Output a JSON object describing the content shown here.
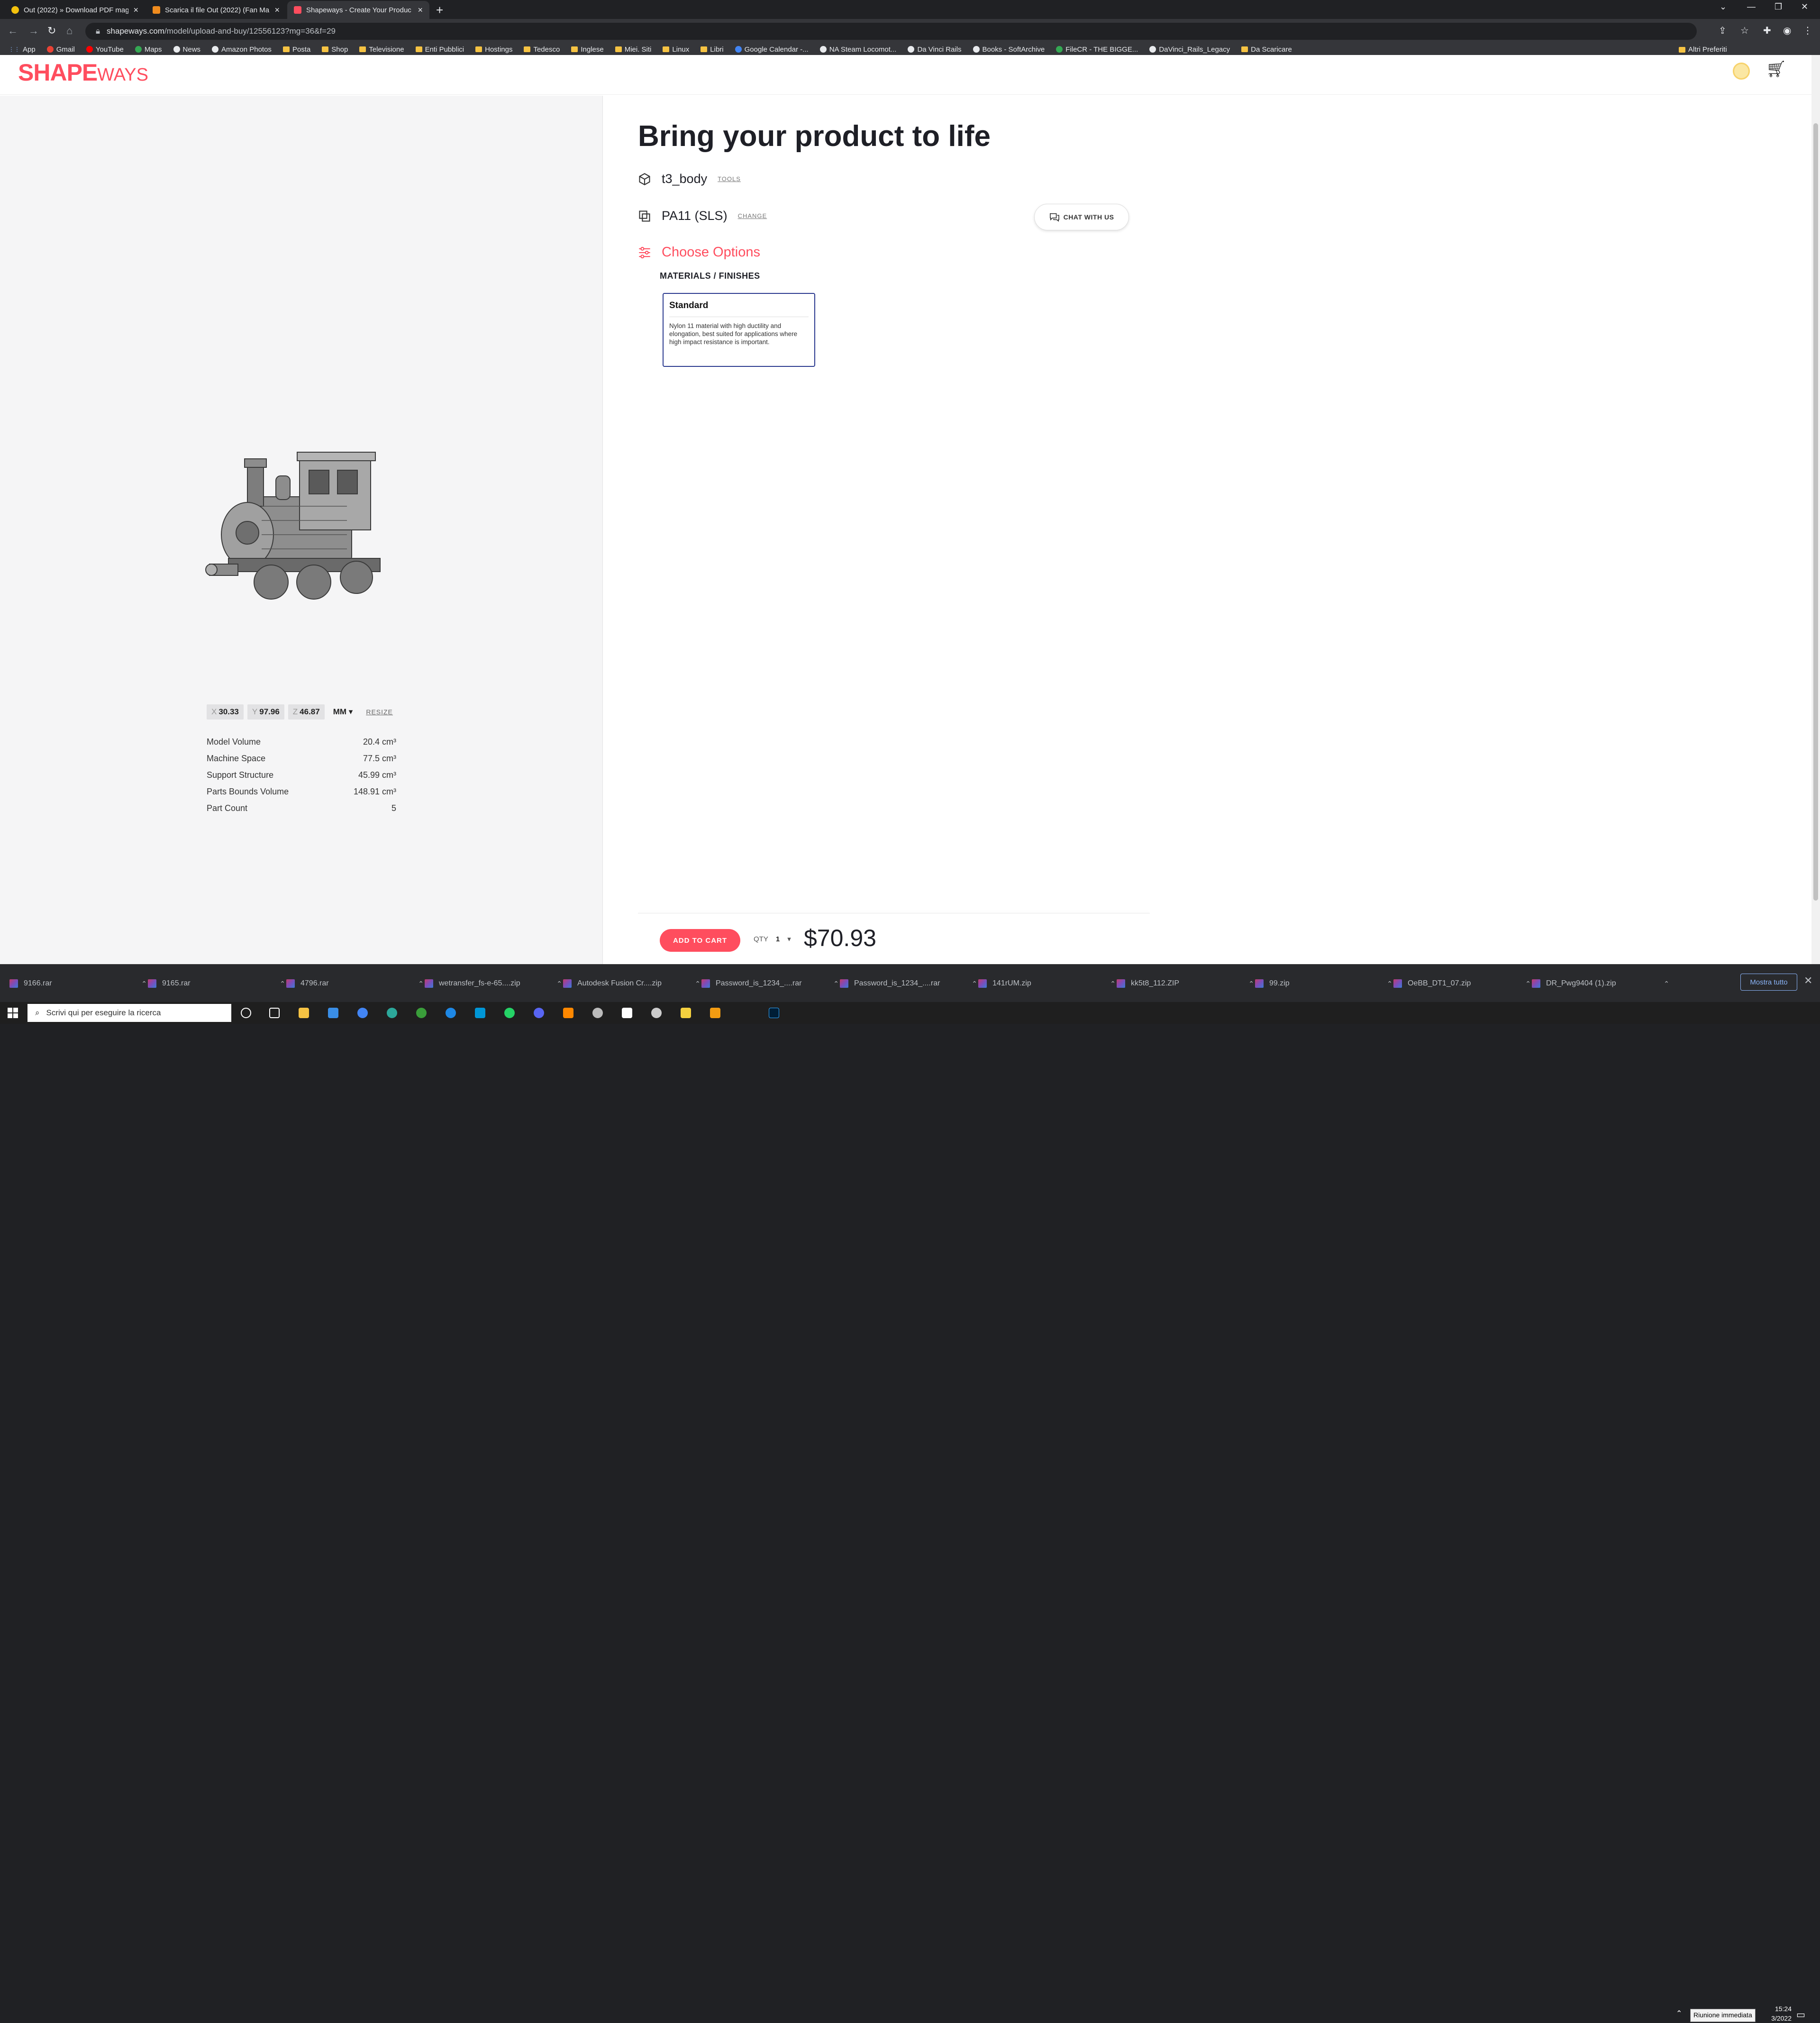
{
  "browser": {
    "tabs": [
      {
        "label": "Out (2022) » Download PDF mag",
        "favicon_color": "#f4c20d",
        "active": false
      },
      {
        "label": "Scarica il file Out (2022) (Fan Ma",
        "favicon_color": "#f08c1e",
        "active": false
      },
      {
        "label": "Shapeways - Create Your Produc",
        "favicon_color": "#ff4d5e",
        "active": true
      }
    ],
    "url_host": "shapeways.com",
    "url_path": "/model/upload-and-buy/12556123?mg=36&f=29",
    "bookmarks": [
      {
        "label": "App",
        "kind": "apps"
      },
      {
        "label": "Gmail",
        "kind": "site",
        "color": "#ea4335"
      },
      {
        "label": "YouTube",
        "kind": "site",
        "color": "#ff0000"
      },
      {
        "label": "Maps",
        "kind": "site",
        "color": "#34a853"
      },
      {
        "label": "News",
        "kind": "site",
        "color": "#e8eaed"
      },
      {
        "label": "Amazon Photos",
        "kind": "site",
        "color": "#e8eaed"
      },
      {
        "label": "Posta",
        "kind": "folder"
      },
      {
        "label": "Shop",
        "kind": "folder"
      },
      {
        "label": "Televisione",
        "kind": "folder"
      },
      {
        "label": "Enti Pubblici",
        "kind": "folder"
      },
      {
        "label": "Hostings",
        "kind": "folder"
      },
      {
        "label": "Tedesco",
        "kind": "folder"
      },
      {
        "label": "Inglese",
        "kind": "folder"
      },
      {
        "label": "Miei. Siti",
        "kind": "folder"
      },
      {
        "label": "Linux",
        "kind": "folder"
      },
      {
        "label": "Libri",
        "kind": "folder"
      },
      {
        "label": "Google Calendar -...",
        "kind": "site",
        "color": "#4285f4"
      },
      {
        "label": "NA Steam Locomot...",
        "kind": "site",
        "color": "#e8eaed"
      },
      {
        "label": "Da Vinci Rails",
        "kind": "site",
        "color": "#e8eaed"
      },
      {
        "label": "Books - SoftArchive",
        "kind": "site",
        "color": "#e8eaed"
      },
      {
        "label": "FileCR - THE BIGGE...",
        "kind": "site",
        "color": "#34a853"
      },
      {
        "label": "DaVinci_Rails_Legacy",
        "kind": "site",
        "color": "#e8eaed"
      },
      {
        "label": "Da Scaricare",
        "kind": "folder"
      }
    ],
    "other_bookmarks": "Altri Preferiti"
  },
  "site": {
    "logo_main": "SHAPE",
    "logo_sub": "WAYS"
  },
  "model_panel": {
    "dims": [
      {
        "axis": "X",
        "value": "30.33"
      },
      {
        "axis": "Y",
        "value": "97.96"
      },
      {
        "axis": "Z",
        "value": "46.87"
      }
    ],
    "unit": "MM",
    "resize_label": "RESIZE",
    "stats": [
      {
        "label": "Model Volume",
        "value": "20.4 cm³"
      },
      {
        "label": "Machine Space",
        "value": "77.5 cm³"
      },
      {
        "label": "Support Structure",
        "value": "45.99 cm³"
      },
      {
        "label": "Parts Bounds Volume",
        "value": "148.91 cm³"
      },
      {
        "label": "Part Count",
        "value": "5"
      }
    ]
  },
  "product": {
    "headline": "Bring your product to life",
    "model_name": "t3_body",
    "tools_link": "TOOLS",
    "material": "PA11 (SLS)",
    "change_link": "CHANGE",
    "chat_label": "CHAT WITH US",
    "choose_options": "Choose Options",
    "materials_label": "MATERIALS / FINISHES",
    "card": {
      "title": "Standard",
      "description": "Nylon 11 material with high ductility and elongation, best suited for applications where high impact resistance is important."
    },
    "add_to_cart": "ADD TO CART",
    "qty_label": "QTY",
    "qty_value": "1",
    "price": "$70.93"
  },
  "downloads": {
    "items": [
      "9166.rar",
      "9165.rar",
      "4796.rar",
      "wetransfer_fs-e-65....zip",
      "Autodesk Fusion Cr....zip",
      "Password_is_1234_....rar",
      "Password_is_1234_....rar",
      "141rUM.zip",
      "kk5t8_112.ZIP",
      "99.zip",
      "OeBB_DT1_07.zip",
      "DR_Pwg9404 (1).zip"
    ],
    "show_all": "Mostra tutto"
  },
  "taskbar": {
    "search_placeholder": "Scrivi qui per eseguire la ricerca",
    "tooltip": "Riunione immediata",
    "time": "15:24",
    "date": "3/2022"
  }
}
